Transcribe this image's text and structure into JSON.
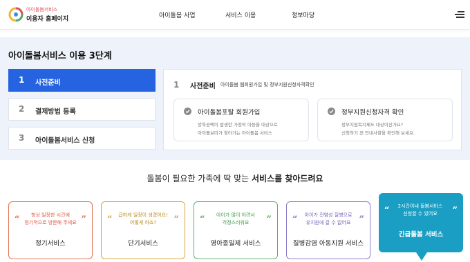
{
  "header": {
    "brand_top": "아이돌봄서비스",
    "brand_main": "이용자 홈페이지",
    "nav": [
      {
        "label": "아이돌봄 사업"
      },
      {
        "label": "서비스 이용"
      },
      {
        "label": "정보마당"
      }
    ],
    "menu_icon": "hamburger-menu-icon"
  },
  "steps": {
    "title": "아이돌봄서비스 이용 3단계",
    "items": [
      {
        "num": "1",
        "label": "사전준비",
        "active": true
      },
      {
        "num": "2",
        "label": "결제방법 등록",
        "active": false
      },
      {
        "num": "3",
        "label": "아이돌봄서비스 신청",
        "active": false
      }
    ],
    "detail": {
      "num": "1",
      "title": "사전준비",
      "desc": "아이돌봄 웹회원가입 및 정부지원신청자격확인",
      "cards": [
        {
          "title": "아이돌봄포탈 회원가입",
          "line1": "양육공백이 발생한 가정의 아동을 대상으로",
          "line2": "아이돌보미가 찾아가는 아이돌봄 서비스"
        },
        {
          "title": "정부지원신청자격 확인",
          "line1": "정부지원복지제도 대상이신가요?",
          "line2": "신청하기 전 안내사항을 확인해 보세요."
        }
      ]
    }
  },
  "services": {
    "title_prefix": "돌봄이 필요한 가족에 딱 맞는",
    "title_bold": "서비스를 찾아드려요",
    "items": [
      {
        "tag1": "항상 일정한 시간에",
        "tag2": "정기적으로 방문해 주세요",
        "name": "정기서비스",
        "color": "#e2724f",
        "tagColor": "#d9553c"
      },
      {
        "tag1": "급하게 일정이 생겼어요!",
        "tag2": "어떻게 하죠?",
        "name": "단기서비스",
        "color": "#d4a63c",
        "tagColor": "#b88a1f"
      },
      {
        "tag1": "아이가 많이 어려서",
        "tag2": "걱정스러워요",
        "name": "영아종일제 서비스",
        "color": "#5fae6a",
        "tagColor": "#3e9a4b"
      },
      {
        "tag1": "아이가 전염성 질병으로",
        "tag2": "유치원에 갈 수 없어요",
        "name": "질병감염 아동지원 서비스",
        "color": "#8c7cc8",
        "tagColor": "#7360b8"
      },
      {
        "tag1": "2시간이내 돌봄서비스",
        "tag2": "신청할 수 있어요",
        "name": "긴급돌봄 서비스",
        "color": "#1a9ec4",
        "tagColor": "#ffffff"
      }
    ]
  },
  "colors": {
    "accent": "#2563e0",
    "section_bg": "#eef3fb",
    "urgent": "#1a9ec4"
  }
}
